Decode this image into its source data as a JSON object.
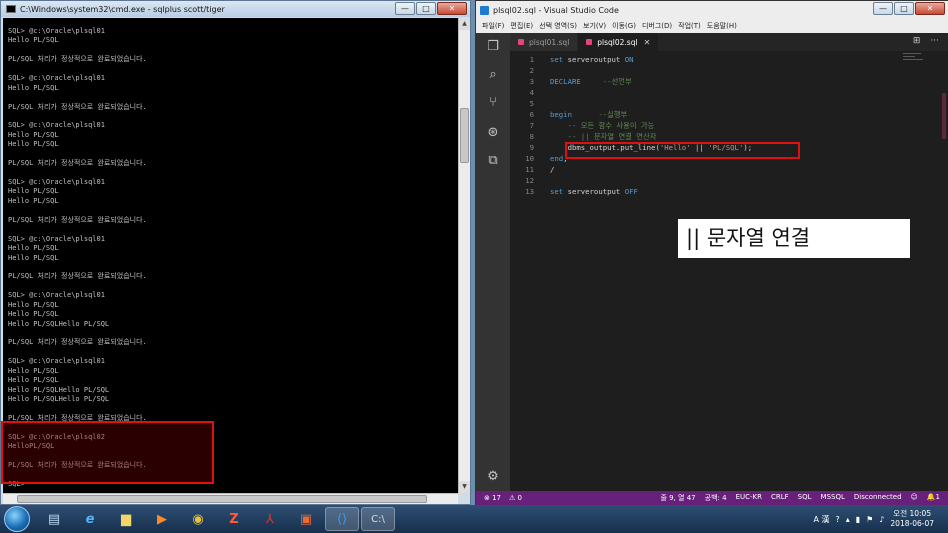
{
  "cmd": {
    "title": "C:\\Windows\\system32\\cmd.exe - sqlplus  scott/tiger",
    "buttons": {
      "minimize": "—",
      "maximize": "□",
      "close": "✕"
    },
    "lines": [
      "SQL> @c:\\Oracle\\plsql01",
      "Hello PL/SQL",
      "",
      "PL/SQL 처리가 정상적으로 완료되었습니다.",
      "",
      "SQL> @c:\\Oracle\\plsql01",
      "Hello PL/SQL",
      "",
      "PL/SQL 처리가 정상적으로 완료되었습니다.",
      "",
      "SQL> @c:\\Oracle\\plsql01",
      "Hello PL/SQL",
      "Hello PL/SQL",
      "",
      "PL/SQL 처리가 정상적으로 완료되었습니다.",
      "",
      "SQL> @c:\\Oracle\\plsql01",
      "Hello PL/SQL",
      "Hello PL/SQL",
      "",
      "PL/SQL 처리가 정상적으로 완료되었습니다.",
      "",
      "SQL> @c:\\Oracle\\plsql01",
      "Hello PL/SQL",
      "Hello PL/SQL",
      "",
      "PL/SQL 처리가 정상적으로 완료되었습니다.",
      "",
      "SQL> @c:\\Oracle\\plsql01",
      "Hello PL/SQL",
      "Hello PL/SQL",
      "Hello PL/SQLHello PL/SQL",
      "",
      "PL/SQL 처리가 정상적으로 완료되었습니다.",
      "",
      "SQL> @c:\\Oracle\\plsql01",
      "Hello PL/SQL",
      "Hello PL/SQL",
      "Hello PL/SQLHello PL/SQL",
      "Hello PL/SQLHello PL/SQL",
      "",
      "PL/SQL 처리가 정상적으로 완료되었습니다.",
      "",
      "SQL> @c:\\Oracle\\plsql02",
      "HelloPL/SQL",
      "",
      "PL/SQL 처리가 정상적으로 완료되었습니다.",
      "",
      "SQL>"
    ]
  },
  "vscode": {
    "title": "plsql02.sql - Visual Studio Code",
    "buttons": {
      "minimize": "—",
      "maximize": "□",
      "close": "✕"
    },
    "menu": [
      "파일(F)",
      "편집(E)",
      "선택 영역(S)",
      "보기(V)",
      "이동(G)",
      "디버그(D)",
      "작업(T)",
      "도움말(H)"
    ],
    "tabs": [
      {
        "label": "plsql01.sql",
        "active": false
      },
      {
        "label": "plsql02.sql",
        "active": true,
        "close": "✕"
      }
    ],
    "tab_actions": [
      "⊞",
      "···"
    ],
    "code": [
      {
        "n": "1",
        "parts": [
          [
            "kw",
            "set "
          ],
          [
            "pl",
            "serveroutput "
          ],
          [
            "kw",
            "ON"
          ]
        ]
      },
      {
        "n": "2",
        "parts": []
      },
      {
        "n": "3",
        "parts": [
          [
            "kw",
            "DECLARE"
          ],
          [
            "pl",
            "     "
          ],
          [
            "cm",
            "--선언부"
          ]
        ]
      },
      {
        "n": "4",
        "parts": []
      },
      {
        "n": "5",
        "parts": []
      },
      {
        "n": "6",
        "parts": [
          [
            "kw",
            "begin"
          ],
          [
            "pl",
            "      "
          ],
          [
            "cm",
            "--실행부"
          ]
        ]
      },
      {
        "n": "7",
        "parts": [
          [
            "pl",
            "    "
          ],
          [
            "cm",
            "-- 모든 함수 사용이 가능"
          ]
        ]
      },
      {
        "n": "8",
        "parts": [
          [
            "pl",
            "    "
          ],
          [
            "cm",
            "-- || 문자열 연결 연산자"
          ]
        ]
      },
      {
        "n": "9",
        "parts": [
          [
            "pl",
            "    "
          ],
          [
            "fn",
            "dbms_output.put_line("
          ],
          [
            "st",
            "'Hello'"
          ],
          [
            "pl",
            " || "
          ],
          [
            "st",
            "'PL/SQL'"
          ],
          [
            "fn",
            ");"
          ]
        ]
      },
      {
        "n": "10",
        "parts": [
          [
            "kw",
            "end"
          ],
          [
            "pl",
            ";"
          ]
        ]
      },
      {
        "n": "11",
        "parts": [
          [
            "pl",
            "/"
          ]
        ]
      },
      {
        "n": "12",
        "parts": []
      },
      {
        "n": "13",
        "parts": [
          [
            "kw",
            "set "
          ],
          [
            "pl",
            "serveroutput "
          ],
          [
            "kw",
            "OFF"
          ]
        ]
      }
    ],
    "callout": "|| 문자열 연결",
    "status": {
      "errors": "⊗ 17",
      "warnings": "⚠ 0",
      "position": "줄 9, 열 47",
      "indent": "공백: 4",
      "encoding": "EUC-KR",
      "eol": "CRLF",
      "language": "SQL",
      "db": "MSSQL",
      "connection": "Disconnected",
      "feedback": "☺",
      "bell": "🔔1"
    }
  },
  "taskbar": {
    "tray_lang": "A 漢",
    "clock_time": "오전 10:05",
    "clock_date": "2018-06-07"
  },
  "colors": {
    "statusbar": "#68217a",
    "highlight": "#e01010",
    "editor_bg": "#1e1e1e"
  }
}
